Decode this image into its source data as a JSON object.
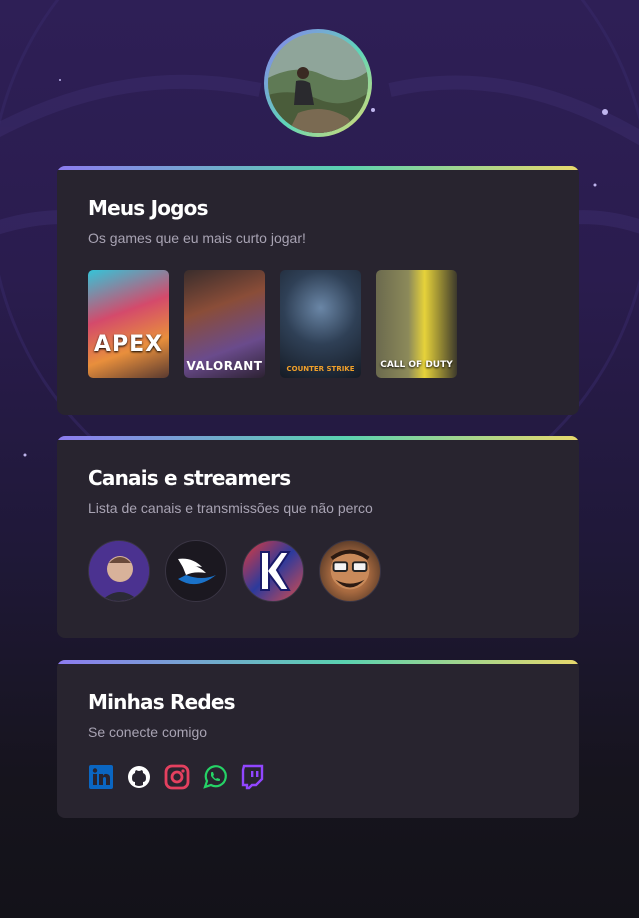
{
  "profile": {
    "avatar_icon": "profile-photo"
  },
  "cards": {
    "games": {
      "title": "Meus Jogos",
      "subtitle": "Os games que eu mais curto jogar!",
      "items": [
        {
          "label": "APEX",
          "icon": "apex-legends-cover"
        },
        {
          "label": "VALORANT",
          "icon": "valorant-cover"
        },
        {
          "label": "COUNTER STRIKE",
          "icon": "counter-strike-cover"
        },
        {
          "label": "CALL OF DUTY",
          "icon": "call-of-duty-warzone-cover"
        }
      ]
    },
    "streamers": {
      "title": "Canais e streamers",
      "subtitle": "Lista de canais e transmissões que não perco",
      "items": [
        {
          "icon": "streamer-1-avatar"
        },
        {
          "icon": "streamer-2-avatar"
        },
        {
          "icon": "streamer-3-avatar"
        },
        {
          "icon": "streamer-4-avatar"
        }
      ]
    },
    "socials": {
      "title": "Minhas Redes",
      "subtitle": "Se conecte comigo",
      "items": [
        {
          "icon": "linkedin-icon",
          "color": "#0a66c2"
        },
        {
          "icon": "github-icon",
          "color": "#ffffff"
        },
        {
          "icon": "instagram-icon",
          "color": "#e4405f"
        },
        {
          "icon": "whatsapp-icon",
          "color": "#25d366"
        },
        {
          "icon": "twitch-icon",
          "color": "#9146ff"
        }
      ]
    }
  },
  "theme": {
    "gradient": [
      "#8d7cf0",
      "#5ad2b0",
      "#e8d86c"
    ],
    "card_bg": "#28242f"
  }
}
